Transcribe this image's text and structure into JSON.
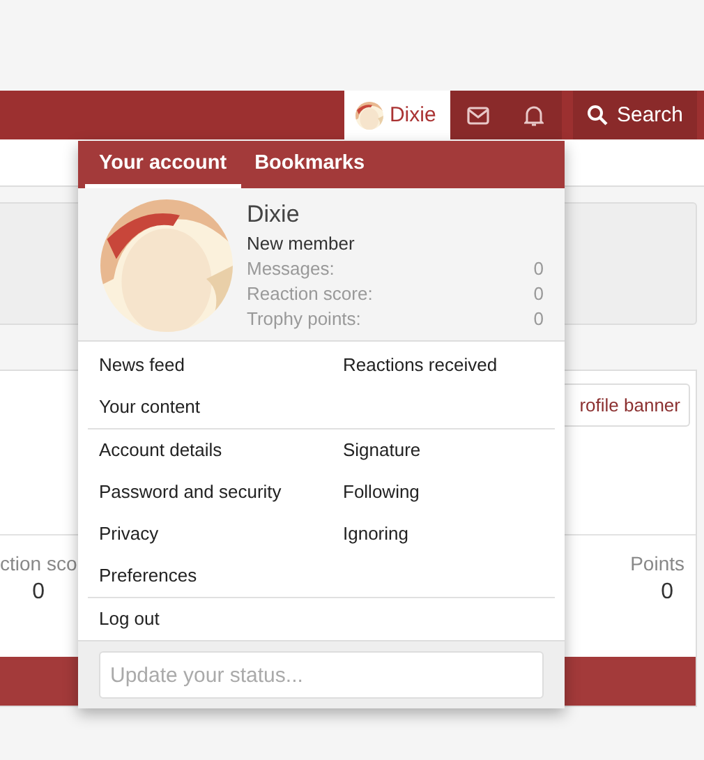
{
  "navbar": {
    "user": {
      "name": "Dixie",
      "selected": true
    },
    "search": {
      "label": "Search"
    }
  },
  "background": {
    "banner_button": "rofile banner",
    "stats": [
      {
        "label": "ction sco",
        "value": "0"
      },
      {
        "label": "Points",
        "value": "0"
      }
    ]
  },
  "account_menu": {
    "tabs": [
      {
        "label": "Your account",
        "selected": true
      },
      {
        "label": "Bookmarks",
        "selected": false
      }
    ],
    "profile": {
      "name": "Dixie",
      "title": "New member",
      "stats": [
        {
          "label": "Messages:",
          "value": "0"
        },
        {
          "label": "Reaction score:",
          "value": "0"
        },
        {
          "label": "Trophy points:",
          "value": "0"
        }
      ]
    },
    "sections": [
      {
        "items": [
          "News feed",
          "Reactions received",
          "Your content"
        ]
      },
      {
        "items": [
          "Account details",
          "Signature",
          "Password and security",
          "Following",
          "Privacy",
          "Ignoring",
          "Preferences"
        ]
      },
      {
        "items": [
          "Log out"
        ]
      }
    ],
    "status": {
      "placeholder": "Update your status..."
    }
  }
}
